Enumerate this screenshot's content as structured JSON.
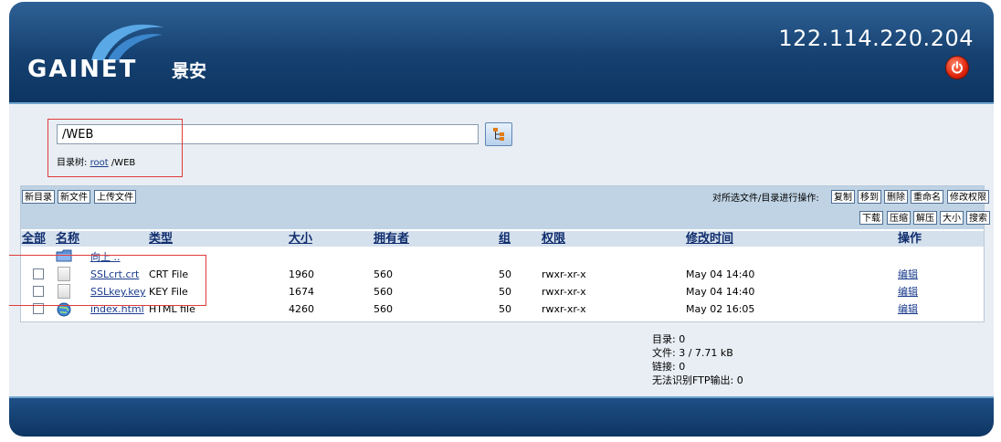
{
  "brand": {
    "logo_text": "GAINET",
    "logo_cn": "景安"
  },
  "header": {
    "ip": "122.114.220.204"
  },
  "path": {
    "value": "/WEB"
  },
  "dirtree": {
    "label": "目录树:",
    "root_link": "root",
    "current": "/WEB"
  },
  "toolbar": {
    "new_dir": "新目录",
    "new_file": "新文件",
    "upload": "上传文件",
    "ops_label": "对所选文件/目录进行操作:",
    "copy": "复制",
    "move": "移到",
    "delete": "删除",
    "rename": "重命名",
    "chmod": "修改权限",
    "download": "下载",
    "zip": "压缩",
    "unzip": "解压",
    "size": "大小",
    "search": "搜索"
  },
  "columns": {
    "all": "全部",
    "name": "名称",
    "type": "类型",
    "size": "大小",
    "owner": "拥有者",
    "group": "组",
    "perm": "权限",
    "mtime": "修改时间",
    "action": "操作"
  },
  "up_label": "向上 ..",
  "files": [
    {
      "name": "SSLcrt.crt",
      "type": "CRT File",
      "size": "1960",
      "owner": "560",
      "group": "50",
      "perm": "rwxr-xr-x",
      "mtime": "May 04 14:40",
      "action": "编辑",
      "icon": "file-icon"
    },
    {
      "name": "SSLkey.key",
      "type": "KEY File",
      "size": "1674",
      "owner": "560",
      "group": "50",
      "perm": "rwxr-xr-x",
      "mtime": "May 04 14:40",
      "action": "编辑",
      "icon": "file-icon"
    },
    {
      "name": "index.html",
      "type": "HTML file",
      "size": "4260",
      "owner": "560",
      "group": "50",
      "perm": "rwxr-xr-x",
      "mtime": "May 02 16:05",
      "action": "编辑",
      "icon": "html-globe-icon"
    }
  ],
  "stats": {
    "dirs": "目录: 0",
    "files": "文件: 3 / 7.71 kB",
    "links": "链接: 0",
    "unknown": "无法识别FTP输出: 0"
  },
  "colors": {
    "header": "#15406f",
    "accent": "#bfd3e4",
    "annotation": "#e23a3a"
  }
}
